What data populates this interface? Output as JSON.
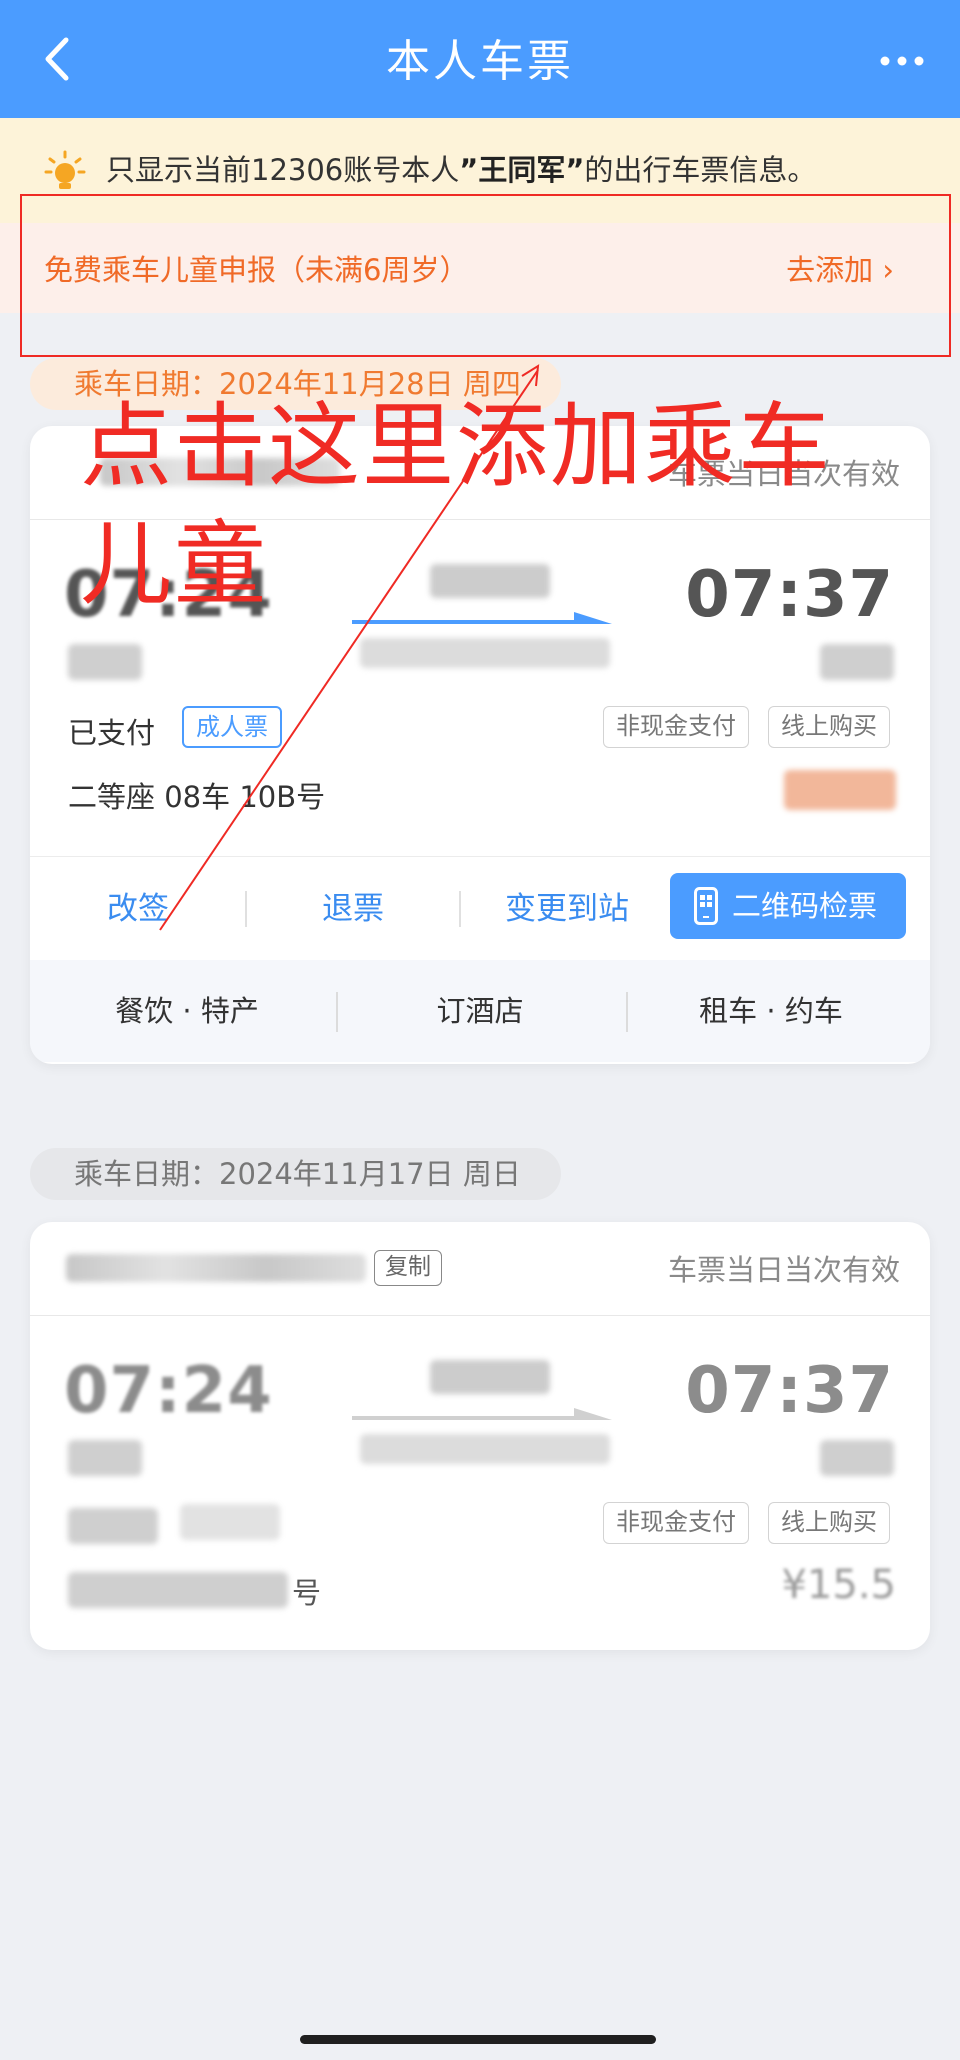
{
  "header": {
    "title": "本人车票"
  },
  "notice": {
    "prefix": "只显示当前12306账号本人",
    "name": "”王同军”",
    "suffix": "的出行车票信息。"
  },
  "child_declaration": {
    "label": "免费乘车儿童申报（未满6周岁）",
    "action": "去添加"
  },
  "annotation": {
    "text": "点击这里添加乘车儿童",
    "color": "#f02b24"
  },
  "tickets": [
    {
      "date_label": "乘车日期：2024年11月28日 周四",
      "validity": "车票当日当次有效",
      "depart_time": "07:24",
      "arrive_time": "07:37",
      "pay_status": "已支付",
      "ticket_type": "成人票",
      "tags": [
        "非现金支付",
        "线上购买"
      ],
      "seat": "二等座 08车 10B号",
      "actions": [
        "改签",
        "退票",
        "变更到站"
      ],
      "qr_button": "二维码检票",
      "services": [
        "餐饮 · 特产",
        "订酒店",
        "租车 · 约车"
      ]
    },
    {
      "date_label": "乘车日期：2024年11月17日 周日",
      "copy_label": "复制",
      "validity": "车票当日当次有效",
      "depart_time": "07:24",
      "arrive_time": "07:37",
      "tags": [
        "非现金支付",
        "线上购买"
      ],
      "seat_suffix": "号",
      "price": "¥15.5"
    }
  ],
  "colors": {
    "primary": "#4b9cff",
    "orange": "#f06a27",
    "annotation": "#f02b24"
  }
}
